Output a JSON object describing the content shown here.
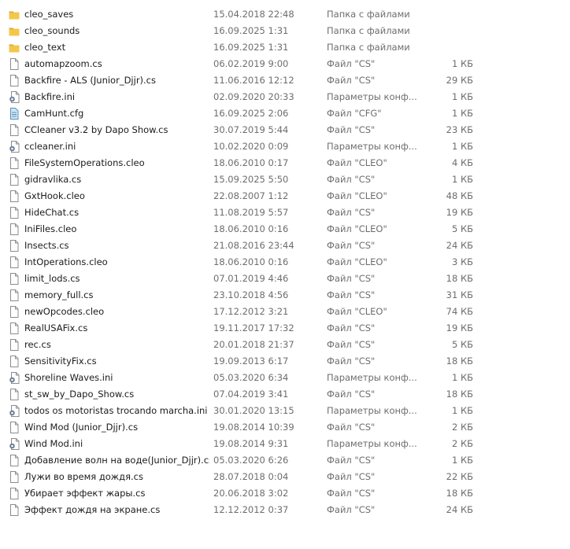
{
  "files": [
    {
      "name": "cleo_saves",
      "date": "15.04.2018 22:48",
      "type": "Папка с файлами",
      "size": "",
      "icon": "folder-icon"
    },
    {
      "name": "cleo_sounds",
      "date": "16.09.2025 1:31",
      "type": "Папка с файлами",
      "size": "",
      "icon": "folder-icon"
    },
    {
      "name": "cleo_text",
      "date": "16.09.2025 1:31",
      "type": "Папка с файлами",
      "size": "",
      "icon": "folder-icon"
    },
    {
      "name": "automapzoom.cs",
      "date": "06.02.2019 9:00",
      "type": "Файл \"CS\"",
      "size": "1 КБ",
      "icon": "file-icon"
    },
    {
      "name": "Backfire - ALS (Junior_Djjr).cs",
      "date": "11.06.2016 12:12",
      "type": "Файл \"CS\"",
      "size": "29 КБ",
      "icon": "file-icon"
    },
    {
      "name": "Backfire.ini",
      "date": "02.09.2020 20:33",
      "type": "Параметры конф...",
      "size": "1 КБ",
      "icon": "settings-file-icon"
    },
    {
      "name": "CamHunt.cfg",
      "date": "16.09.2025 2:06",
      "type": "Файл \"CFG\"",
      "size": "1 КБ",
      "icon": "cfg-file-icon"
    },
    {
      "name": "CCleaner v3.2 by Dapo Show.cs",
      "date": "30.07.2019 5:44",
      "type": "Файл \"CS\"",
      "size": "23 КБ",
      "icon": "file-icon"
    },
    {
      "name": "ccleaner.ini",
      "date": "10.02.2020 0:09",
      "type": "Параметры конф...",
      "size": "1 КБ",
      "icon": "settings-file-icon"
    },
    {
      "name": "FileSystemOperations.cleo",
      "date": "18.06.2010 0:17",
      "type": "Файл \"CLEO\"",
      "size": "4 КБ",
      "icon": "file-icon"
    },
    {
      "name": "gidravlika.cs",
      "date": "15.09.2025 5:50",
      "type": "Файл \"CS\"",
      "size": "1 КБ",
      "icon": "file-icon"
    },
    {
      "name": "GxtHook.cleo",
      "date": "22.08.2007 1:12",
      "type": "Файл \"CLEO\"",
      "size": "48 КБ",
      "icon": "file-icon"
    },
    {
      "name": "HideChat.cs",
      "date": "11.08.2019 5:57",
      "type": "Файл \"CS\"",
      "size": "19 КБ",
      "icon": "file-icon"
    },
    {
      "name": "IniFiles.cleo",
      "date": "18.06.2010 0:16",
      "type": "Файл \"CLEO\"",
      "size": "5 КБ",
      "icon": "file-icon"
    },
    {
      "name": "Insects.cs",
      "date": "21.08.2016 23:44",
      "type": "Файл \"CS\"",
      "size": "24 КБ",
      "icon": "file-icon"
    },
    {
      "name": "IntOperations.cleo",
      "date": "18.06.2010 0:16",
      "type": "Файл \"CLEO\"",
      "size": "3 КБ",
      "icon": "file-icon"
    },
    {
      "name": "limit_lods.cs",
      "date": "07.01.2019 4:46",
      "type": "Файл \"CS\"",
      "size": "18 КБ",
      "icon": "file-icon"
    },
    {
      "name": "memory_full.cs",
      "date": "23.10.2018 4:56",
      "type": "Файл \"CS\"",
      "size": "31 КБ",
      "icon": "file-icon"
    },
    {
      "name": "newOpcodes.cleo",
      "date": "17.12.2012 3:21",
      "type": "Файл \"CLEO\"",
      "size": "74 КБ",
      "icon": "file-icon"
    },
    {
      "name": "RealUSAFix.cs",
      "date": "19.11.2017 17:32",
      "type": "Файл \"CS\"",
      "size": "19 КБ",
      "icon": "file-icon"
    },
    {
      "name": "rec.cs",
      "date": "20.01.2018 21:37",
      "type": "Файл \"CS\"",
      "size": "5 КБ",
      "icon": "file-icon"
    },
    {
      "name": "SensitivityFix.cs",
      "date": "19.09.2013 6:17",
      "type": "Файл \"CS\"",
      "size": "18 КБ",
      "icon": "file-icon"
    },
    {
      "name": "Shoreline Waves.ini",
      "date": "05.03.2020 6:34",
      "type": "Параметры конф...",
      "size": "1 КБ",
      "icon": "settings-file-icon"
    },
    {
      "name": "st_sw_by_Dapo_Show.cs",
      "date": "07.04.2019 3:41",
      "type": "Файл \"CS\"",
      "size": "18 КБ",
      "icon": "file-icon"
    },
    {
      "name": "todos os motoristas trocando marcha.ini",
      "date": "30.01.2020 13:15",
      "type": "Параметры конф...",
      "size": "1 КБ",
      "icon": "settings-file-icon"
    },
    {
      "name": "Wind Mod (Junior_Djjr).cs",
      "date": "19.08.2014 10:39",
      "type": "Файл \"CS\"",
      "size": "2 КБ",
      "icon": "file-icon"
    },
    {
      "name": "Wind Mod.ini",
      "date": "19.08.2014 9:31",
      "type": "Параметры конф...",
      "size": "2 КБ",
      "icon": "settings-file-icon"
    },
    {
      "name": "Добавление волн на воде(Junior_Djjr).cs",
      "date": "05.03.2020 6:26",
      "type": "Файл \"CS\"",
      "size": "1 КБ",
      "icon": "file-icon"
    },
    {
      "name": "Лужи во время дождя.cs",
      "date": "28.07.2018 0:04",
      "type": "Файл \"CS\"",
      "size": "22 КБ",
      "icon": "file-icon"
    },
    {
      "name": "Убирает эффект жары.cs",
      "date": "20.06.2018 3:02",
      "type": "Файл \"CS\"",
      "size": "18 КБ",
      "icon": "file-icon"
    },
    {
      "name": "Эффект дождя на экране.cs",
      "date": "12.12.2012 0:37",
      "type": "Файл \"CS\"",
      "size": "24 КБ",
      "icon": "file-icon"
    }
  ],
  "colors": {
    "folder": "#f4c74b",
    "folder_dark": "#e0a92a",
    "file_border": "#8c8c8c",
    "settings_gear": "#6b7f99",
    "cfg_fill": "#8fc3e8",
    "text": "#1b1b1b",
    "meta_text": "#6d6d6d"
  }
}
